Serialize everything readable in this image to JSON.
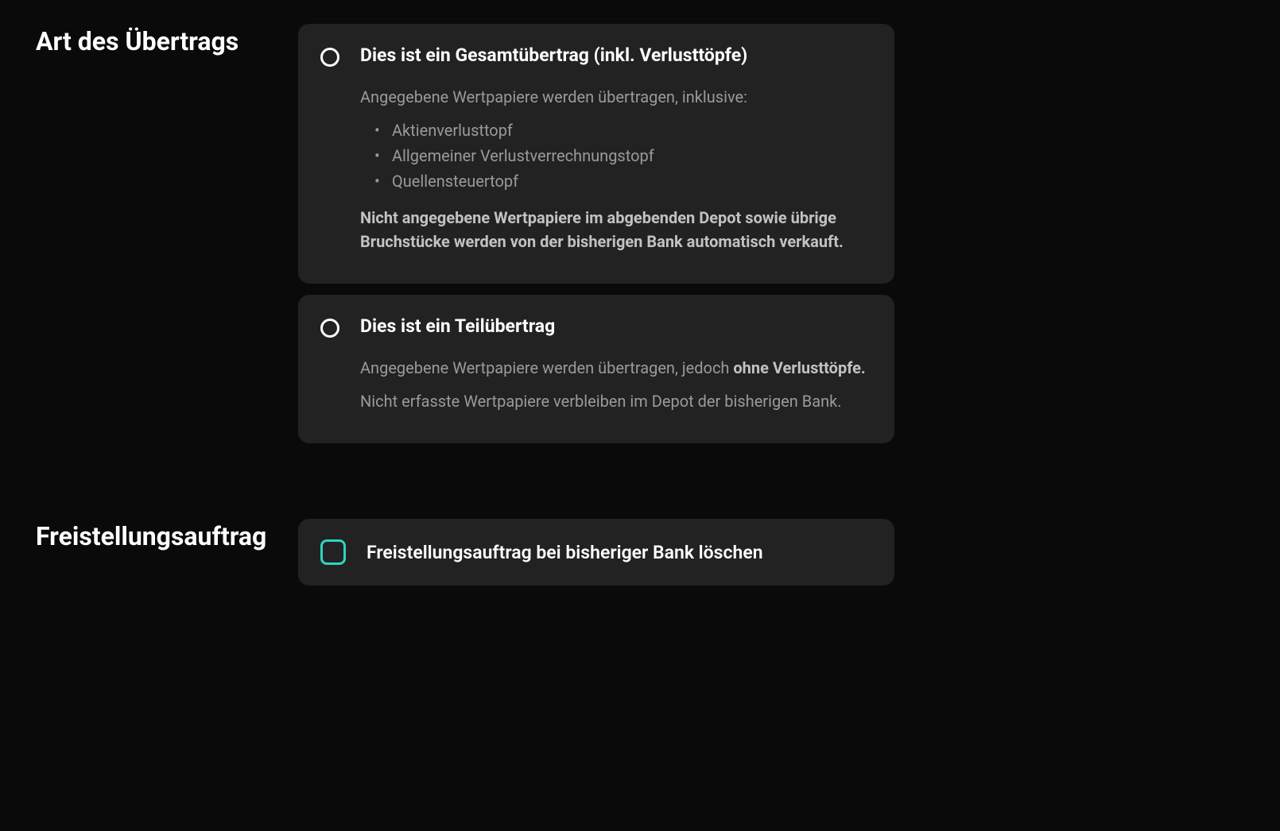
{
  "transferType": {
    "sectionLabel": "Art des Übertrags",
    "option1": {
      "title": "Dies ist ein Gesamtübertrag (inkl. Verlusttöpfe)",
      "intro": "Angegebene Wertpapiere werden übertragen, inklusive:",
      "items": [
        "Aktienverlusttopf",
        "Allgemeiner Verlustverrechnungstopf",
        "Quellensteuertopf"
      ],
      "notice": "Nicht angegebene Wertpapiere im abgebenden Depot sowie übrige Bruchstücke werden von der bisherigen Bank automatisch verkauft."
    },
    "option2": {
      "title": "Dies ist ein Teilübertrag",
      "line1_pre": "Angegebene Wertpapiere werden übertragen, jedoch ",
      "line1_bold": "ohne Verlusttöpfe.",
      "line2": "Nicht erfasste Wertpapiere verbleiben im Depot der bisherigen Bank."
    }
  },
  "exemption": {
    "sectionLabel": "Freistellungs­auftrag",
    "checkboxLabel": "Freistellungsauftrag bei bisheriger Bank löschen"
  },
  "colors": {
    "accent": "#2dd4bf"
  }
}
